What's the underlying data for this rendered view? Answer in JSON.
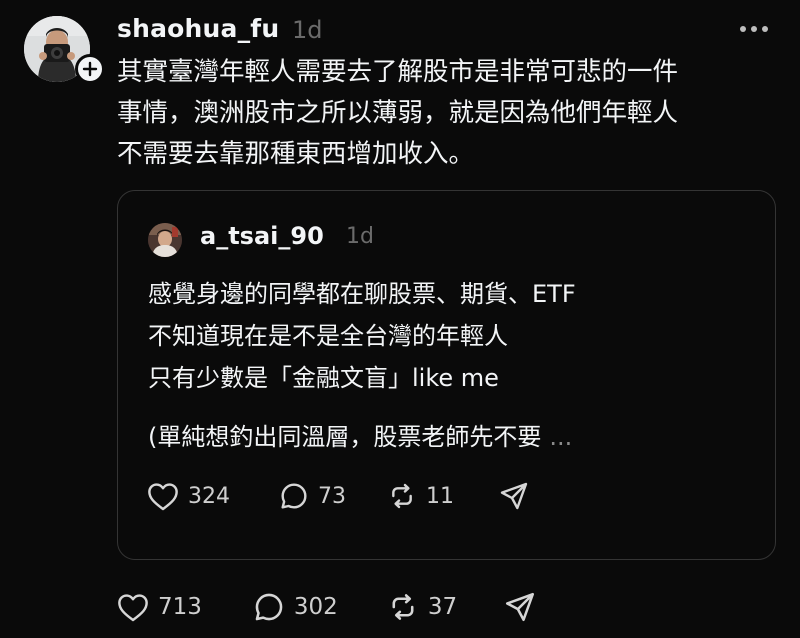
{
  "post": {
    "username": "shaohua_fu",
    "timestamp": "1d",
    "text": "其實臺灣年輕人需要去了解股市是非常可悲的一件\n事情，澳洲股市之所以薄弱，就是因為他們年輕人\n不需要去靠那種東西增加收入。",
    "actions": {
      "likes": "713",
      "replies": "302",
      "reposts": "37"
    }
  },
  "quote": {
    "username": "a_tsai_90",
    "timestamp": "1d",
    "text": "感覺身邊的同學都在聊股票、期貨、ETF\n不知道現在是不是全台灣的年輕人\n只有少數是「金融文盲」like me",
    "truncated": "(單純想釣出同溫層，股票老師先不要",
    "ellipsis": "...",
    "actions": {
      "likes": "324",
      "replies": "73",
      "reposts": "11"
    }
  },
  "icons": {
    "heart": "heart-icon",
    "reply": "reply-icon",
    "repost": "repost-icon",
    "share": "share-icon",
    "more": "more-icon",
    "follow": "follow-plus-icon"
  }
}
